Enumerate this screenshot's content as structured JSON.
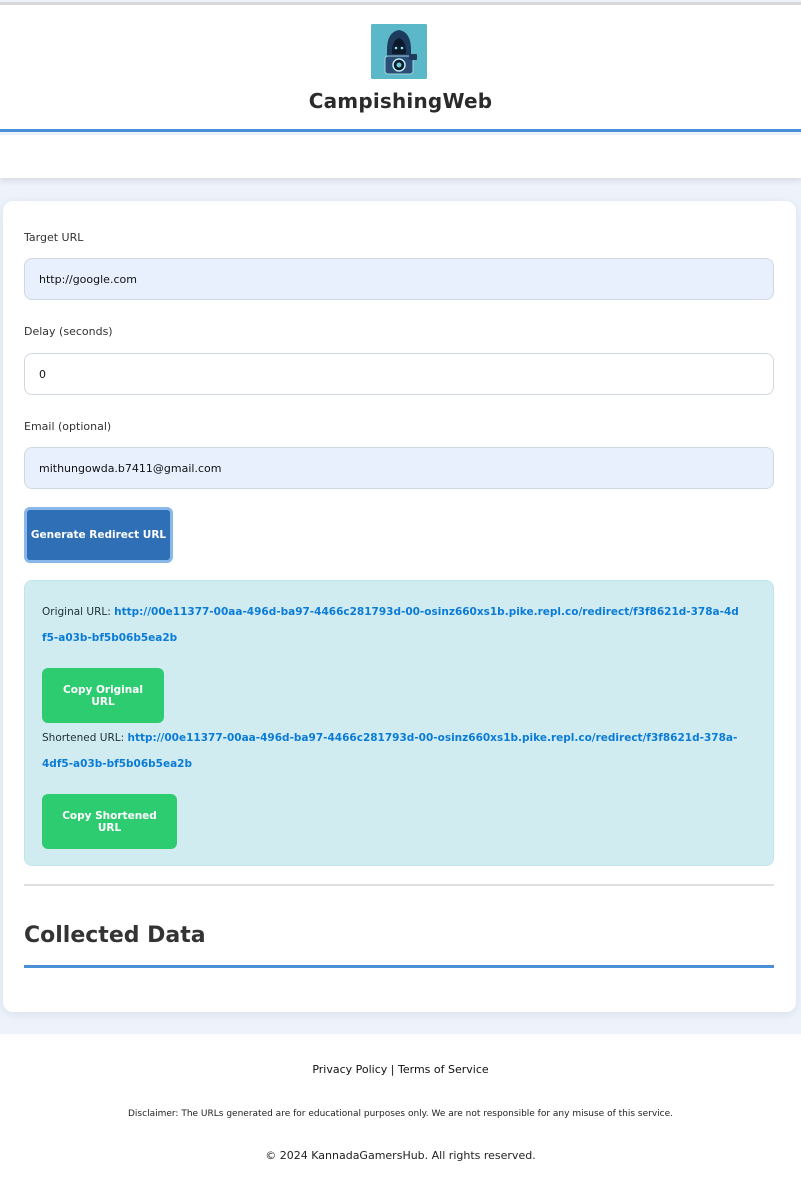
{
  "header": {
    "title": "CampishingWeb",
    "logo_icon": "hooded-hacker-camera-logo"
  },
  "form": {
    "target_url_label": "Target URL",
    "target_url_value": "http://google.com",
    "delay_label": "Delay (seconds)",
    "delay_value": "0",
    "email_label": "Email (optional)",
    "email_value": "mithungowda.b7411@gmail.com",
    "generate_button": "Generate Redirect URL"
  },
  "result": {
    "original_label": "Original URL:",
    "original_url": "http://00e11377-00aa-496d-ba97-4466c281793d-00-osinz660xs1b.pike.repl.co/redirect/f3f8621d-378a-4df5-a03b-bf5b06b5ea2b",
    "copy_original_button": "Copy Original URL",
    "shortened_label": "Shortened URL:",
    "shortened_url": "http://00e11377-00aa-496d-ba97-4466c281793d-00-osinz660xs1b.pike.repl.co/redirect/f3f8621d-378a-4df5-a03b-bf5b06b5ea2b",
    "copy_shortened_button": "Copy Shortened URL"
  },
  "collected": {
    "title": "Collected Data"
  },
  "footer": {
    "privacy_link": "Privacy Policy",
    "separator": "|",
    "terms_link": "Terms of Service",
    "disclaimer": "Disclaimer: The URLs generated are for educational purposes only. We are not responsible for any misuse of this service.",
    "copyright": "© 2024 KannadaGamersHub. All rights reserved."
  },
  "colors": {
    "accent": "#4a90d9",
    "primary_button": "#2f6fb6",
    "copy_button": "#2ecc71",
    "result_bg": "#d1ecf1",
    "link": "#0a7bd6"
  }
}
